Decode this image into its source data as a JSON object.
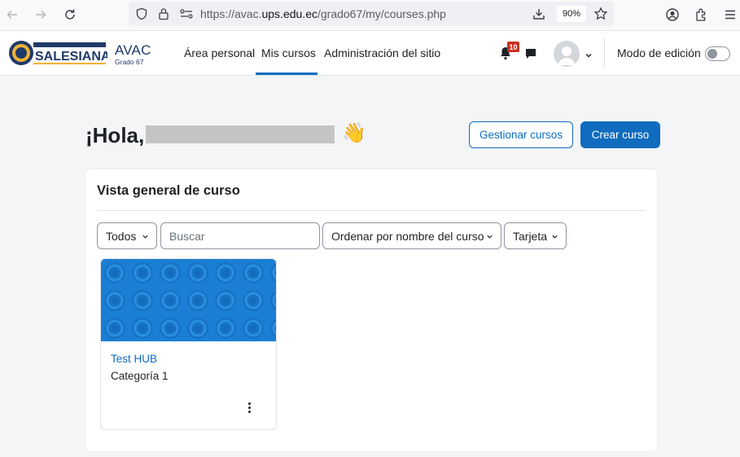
{
  "browser": {
    "url_prefix": "https://avac.",
    "url_host": "ups.edu.ec",
    "url_path": "/grado67/my/courses.php",
    "zoom": "90%"
  },
  "navbar": {
    "brand_title": "AVAC",
    "brand_subtitle": "Grado 67",
    "logo_text": "SALESIANA",
    "links": [
      "Área personal",
      "Mis cursos",
      "Administración del sitio"
    ],
    "notifications_count": "10",
    "edit_mode_label": "Modo de edición"
  },
  "header": {
    "greeting": "¡Hola,",
    "wave": "👋",
    "manage_button": "Gestionar cursos",
    "create_button": "Crear curso"
  },
  "overview": {
    "title": "Vista general de curso",
    "filter_label": "Todos",
    "search_placeholder": "Buscar",
    "sort_label": "Ordenar por nombre del curso",
    "view_label": "Tarjeta",
    "courses": [
      {
        "name": "Test HUB",
        "category": "Categoría 1"
      }
    ]
  },
  "colors": {
    "primary": "#0f6cbf",
    "notification_badge": "#ca3120",
    "course_image": "#1a7fd4"
  }
}
